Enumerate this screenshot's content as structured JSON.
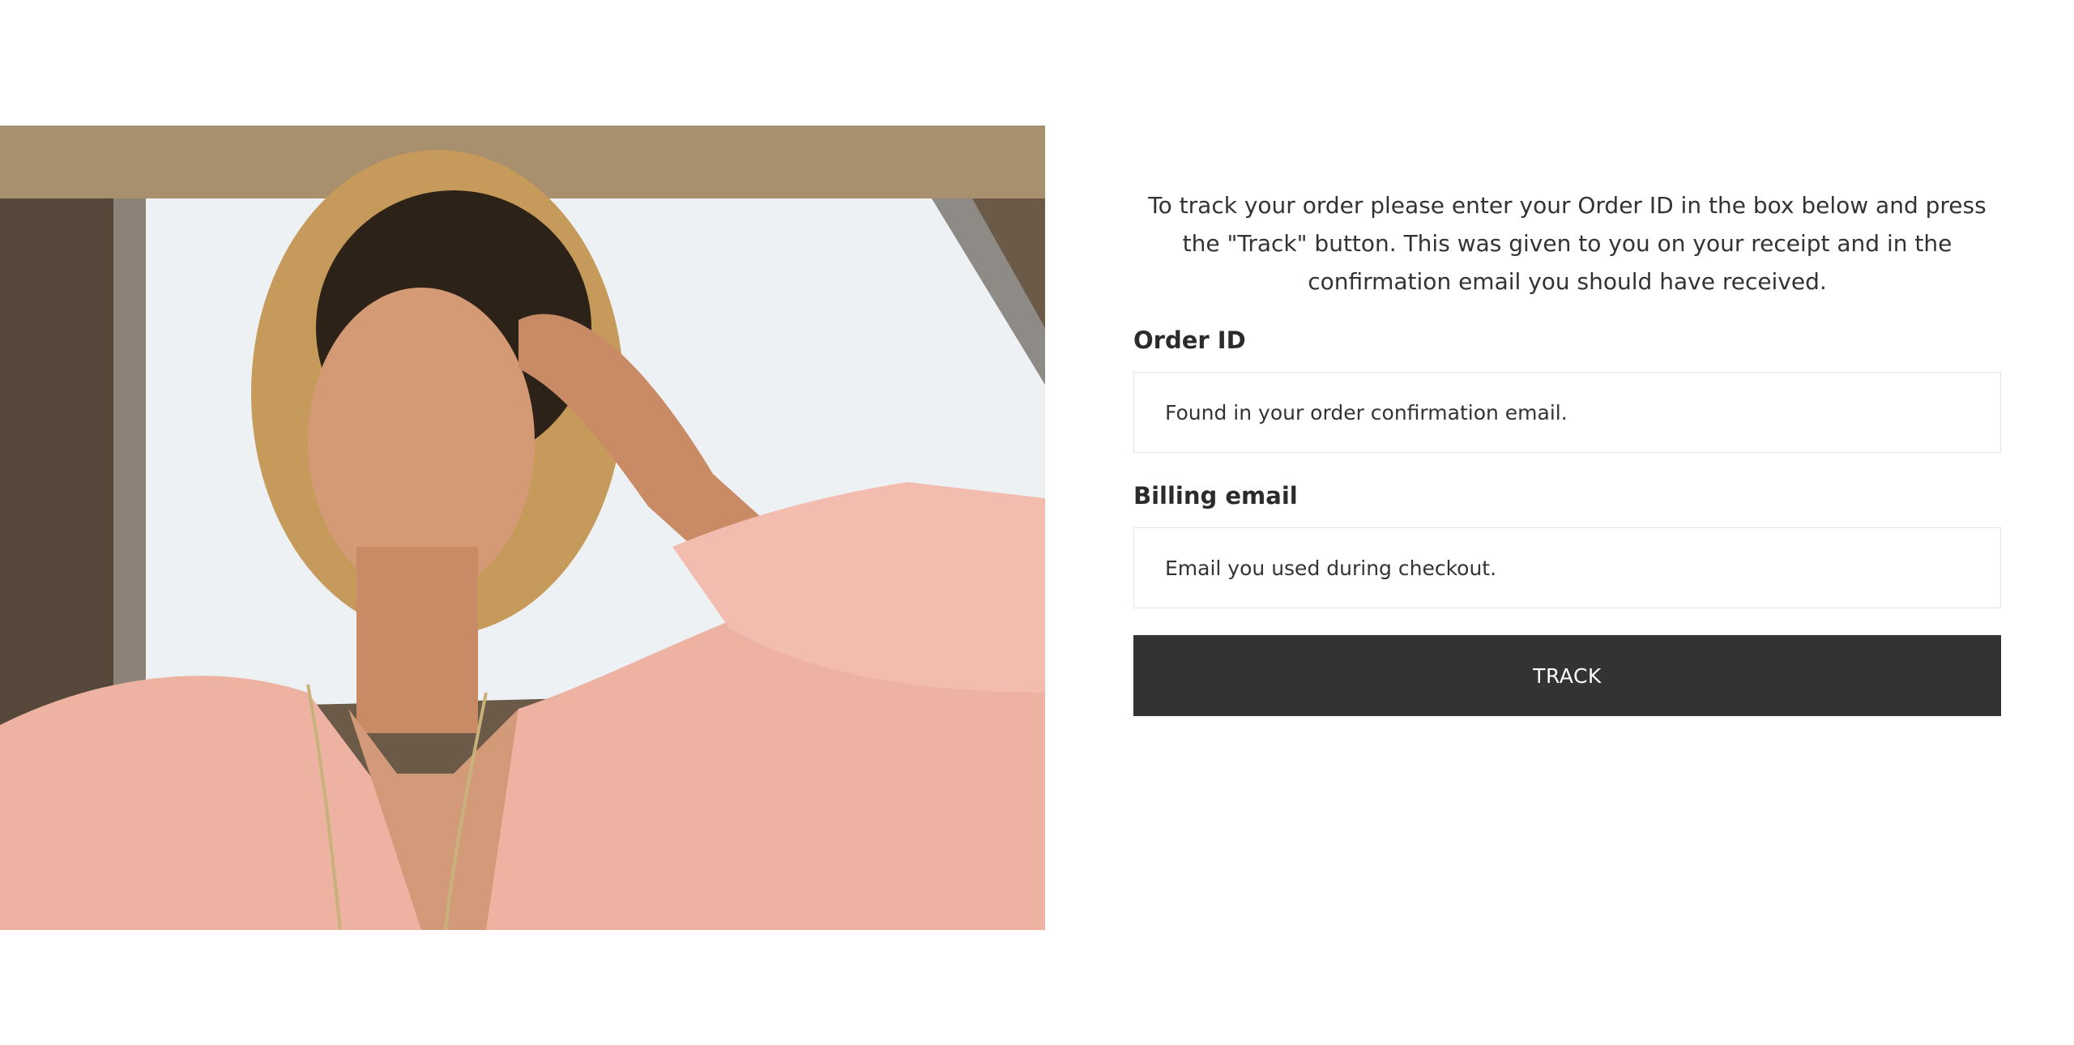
{
  "image": {
    "alt_semantic": "woman-in-pink-blouse-in-vintage-car-photo"
  },
  "tracking": {
    "intro_text": "To track your order please enter your Order ID in the box below and press the \"Track\" button. This was given to you on your receipt and in the confirmation email you should have received.",
    "order_id": {
      "label": "Order ID",
      "value": "",
      "placeholder": "Found in your order confirmation email."
    },
    "billing_email": {
      "label": "Billing email",
      "value": "",
      "placeholder": "Email you used during checkout."
    },
    "submit_label": "TRACK"
  },
  "colors": {
    "button_bg": "#333333",
    "button_text": "#ffffff",
    "text": "#333333",
    "field_border": "#e4e4e4"
  }
}
